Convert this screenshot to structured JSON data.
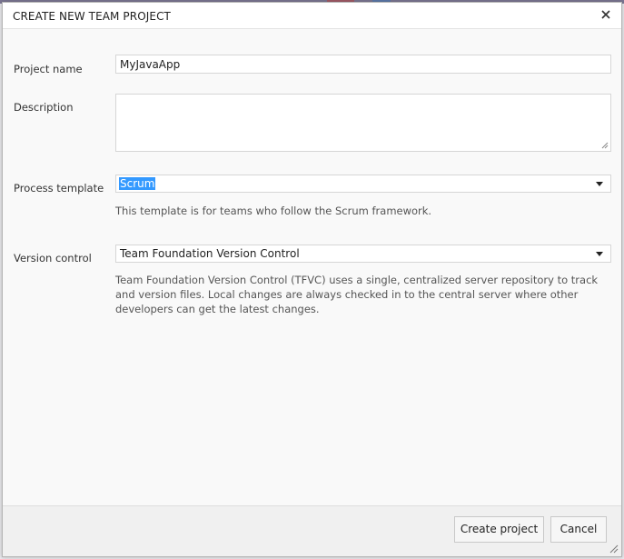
{
  "dialog": {
    "title": "CREATE NEW TEAM PROJECT",
    "close_icon": "close-icon"
  },
  "form": {
    "project_name": {
      "label": "Project name",
      "value": "MyJavaApp"
    },
    "description": {
      "label": "Description",
      "value": ""
    },
    "process_template": {
      "label": "Process template",
      "selected": "Scrum",
      "help": "This template is for teams who follow the Scrum framework."
    },
    "version_control": {
      "label": "Version control",
      "selected": "Team Foundation Version Control",
      "help": "Team Foundation Version Control (TFVC) uses a single, centralized server repository to track and version files. Local changes are always checked in to the central server where other developers can get the latest changes."
    }
  },
  "footer": {
    "create_label": "Create project",
    "cancel_label": "Cancel"
  },
  "colors": {
    "selection": "#3399ff",
    "dialog_bg": "#f9f9f9",
    "footer_bg": "#f0f0f0"
  }
}
